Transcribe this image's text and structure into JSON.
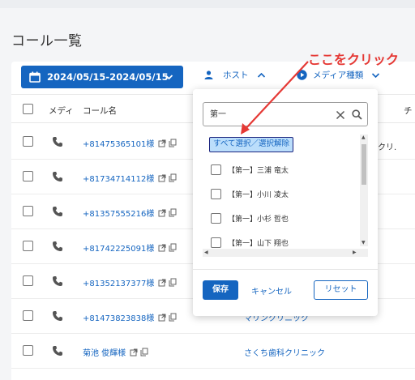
{
  "page": {
    "title": "コール一覧"
  },
  "toolbar": {
    "date_range": "2024/05/15-2024/05/15",
    "host_label": "ホスト",
    "media_label": "メディア種類"
  },
  "table": {
    "headers": [
      "メディ",
      "コール名"
    ],
    "header_cut": "チ",
    "cut_cell": "クリ.",
    "rows": [
      {
        "name": "+81475365101様",
        "clinic": ""
      },
      {
        "name": "+81734714112様",
        "clinic": ""
      },
      {
        "name": "+81357555216様",
        "clinic": ""
      },
      {
        "name": "+81742225091様",
        "clinic": ""
      },
      {
        "name": "+81352137377様",
        "clinic": ""
      },
      {
        "name": "+81473823838様",
        "clinic": "マリンクリニック"
      },
      {
        "name": "菊池 俊輝様",
        "clinic": "さくち歯科クリニック"
      }
    ]
  },
  "popup": {
    "search_value": "第一",
    "select_all": "すべて選択／選択解除",
    "options": [
      "【第一】三浦 竜太",
      "【第一】小川 凌太",
      "【第一】小杉 哲也",
      "【第一】山下 翔也"
    ],
    "save": "保存",
    "cancel": "キャンセル",
    "reset": "リセット"
  },
  "annotation": {
    "text": "ここをクリック",
    "color": "#e53935"
  },
  "colors": {
    "primary": "#1565c0",
    "annotation": "#e53935"
  }
}
